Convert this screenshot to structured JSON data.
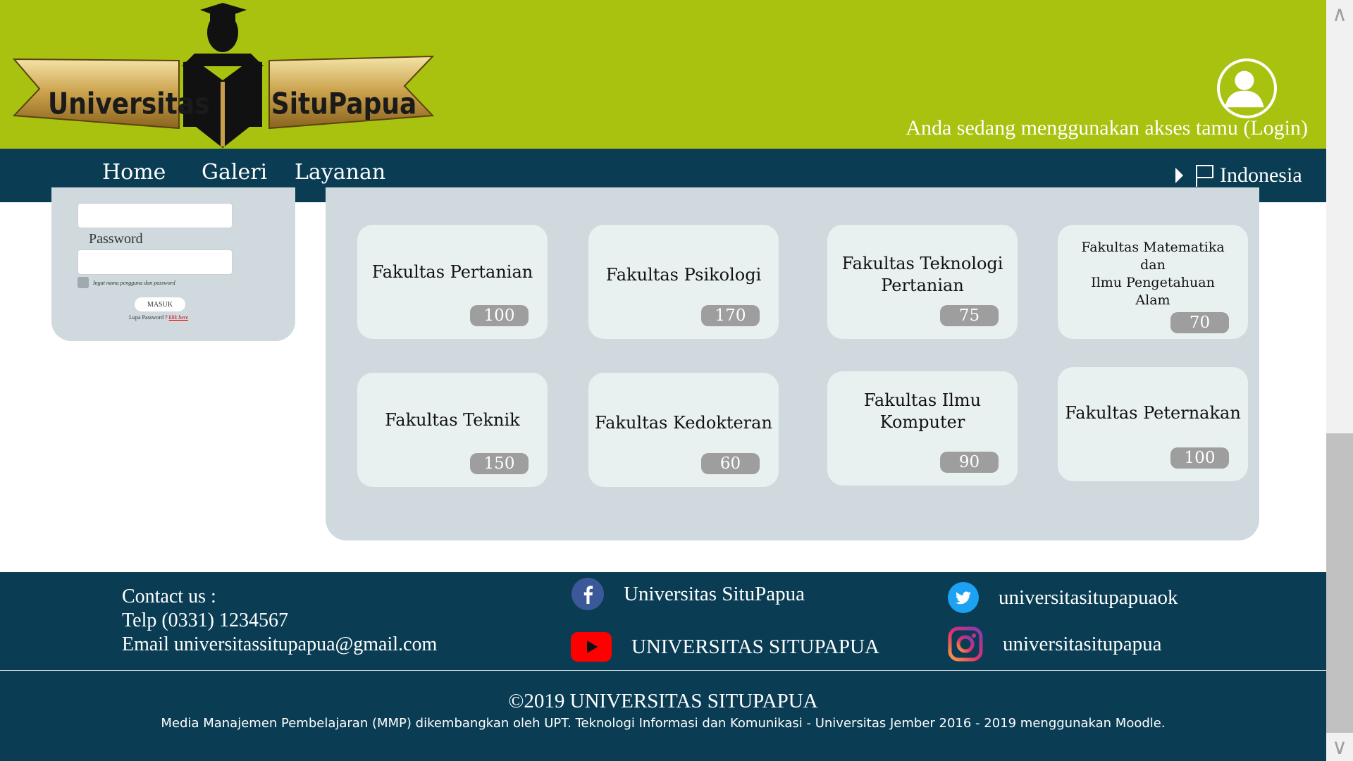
{
  "header": {
    "logo": {
      "left_text": "Universitas",
      "right_text": "SituPapua",
      "icon": "graduate-reading-book-icon"
    },
    "guest_avatar_icon": "user-avatar-icon",
    "guest_text": "Anda sedang menggunakan akses tamu (Login)",
    "colors": {
      "header_bg": "#a9c20f",
      "nav_bg": "#0a3d54"
    }
  },
  "nav": {
    "items": [
      "Home",
      "Galeri",
      "Layanan"
    ],
    "language": {
      "label": "Indonesia",
      "icon": "flag-icon",
      "caret": "caret-right-icon"
    }
  },
  "login": {
    "username_value": "",
    "password_label": "Password",
    "password_value": "",
    "remember_label": "Ingat nama pengguna dan password",
    "submit_label": "MASUK",
    "forgot_text": "Lupa Password ?",
    "forgot_link": "klik here"
  },
  "faculties": [
    {
      "name": "Fakultas Pertanian",
      "count": "100"
    },
    {
      "name": "Fakultas Psikologi",
      "count": "170"
    },
    {
      "name": "Fakultas Teknologi Pertanian",
      "count": "75"
    },
    {
      "name_lines": [
        "Fakultas Matematika",
        "dan",
        "Ilmu Pengetahuan",
        "Alam"
      ],
      "count": "70"
    },
    {
      "name": "Fakultas Teknik",
      "count": "150"
    },
    {
      "name": "Fakultas Kedokteran",
      "count": "60"
    },
    {
      "name": "Fakultas Ilmu Komputer",
      "count": "90"
    },
    {
      "name": "Fakultas Peternakan",
      "count": "100"
    }
  ],
  "footer": {
    "contact": {
      "heading": "Contact us :",
      "phone": "Telp (0331) 1234567",
      "email": "Email universitassitupapua@gmail.com"
    },
    "social": {
      "facebook": {
        "label": "Universitas SituPapua",
        "icon": "facebook-icon"
      },
      "youtube": {
        "label": "UNIVERSITAS SITUPAPUA",
        "icon": "youtube-icon"
      },
      "twitter": {
        "label": "universitasitupapuaok",
        "icon": "twitter-icon"
      },
      "instagram": {
        "label": "universitasitupapua",
        "icon": "instagram-icon"
      }
    },
    "copyright": "©2019 UNIVERSITAS SITUPAPUA",
    "note": "Media Manajemen Pembelajaran (MMP) dikembangkan oleh UPT. Teknologi Informasi dan Komunikasi - Universitas Jember 2016 - 2019 menggunakan Moodle."
  },
  "scrollbar": {
    "up_icon": "scroll-up-arrow-icon",
    "down_icon": "scroll-down-arrow-icon"
  }
}
